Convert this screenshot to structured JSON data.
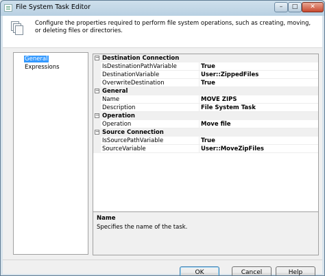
{
  "window": {
    "title": "File System Task Editor",
    "controls": {
      "minimize": "–",
      "maximize": "□",
      "close": "✕"
    }
  },
  "header": {
    "description": "Configure the properties required to perform file system operations, such as creating, moving, or deleting files or directories."
  },
  "nav": {
    "items": [
      {
        "label": "General",
        "selected": true
      },
      {
        "label": "Expressions",
        "selected": false
      }
    ]
  },
  "grid": {
    "categories": [
      {
        "label": "Destination Connection",
        "properties": [
          {
            "name": "IsDestinationPathVariable",
            "value": "True"
          },
          {
            "name": "DestinationVariable",
            "value": "User::ZippedFiles"
          },
          {
            "name": "OverwriteDestination",
            "value": "True"
          }
        ]
      },
      {
        "label": "General",
        "properties": [
          {
            "name": "Name",
            "value": "MOVE ZIPS"
          },
          {
            "name": "Description",
            "value": "File System Task"
          }
        ]
      },
      {
        "label": "Operation",
        "properties": [
          {
            "name": "Operation",
            "value": "Move file"
          }
        ]
      },
      {
        "label": "Source Connection",
        "properties": [
          {
            "name": "IsSourcePathVariable",
            "value": "True"
          },
          {
            "name": "SourceVariable",
            "value": "User::MoveZipFiles"
          }
        ]
      }
    ],
    "collapse_glyph": "−"
  },
  "help": {
    "title": "Name",
    "text": "Specifies the name of the task."
  },
  "buttons": {
    "ok": "OK",
    "cancel": "Cancel",
    "help": "Help"
  }
}
